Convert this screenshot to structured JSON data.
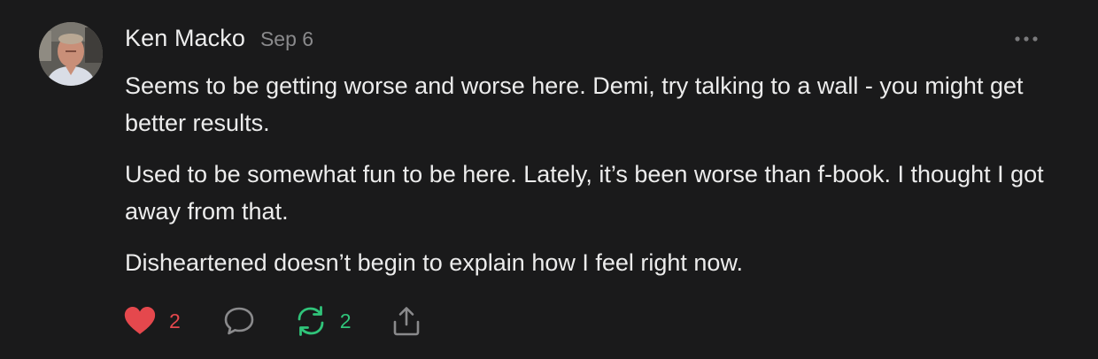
{
  "post": {
    "author": "Ken Macko",
    "date": "Sep 6",
    "paragraphs": [
      "Seems to be getting worse and worse here. Demi, try talking to a wall - you might get better results.",
      "Used to be somewhat fun to be here. Lately, it’s been worse than f-book. I thought I got away from that.",
      "Disheartened doesn’t begin to explain how I feel right now."
    ]
  },
  "actions": {
    "like_count": "2",
    "restack_count": "2"
  },
  "icons": {
    "more": "more-dots-icon",
    "like": "heart-icon",
    "comment": "comment-bubble-icon",
    "restack": "restack-arrows-icon",
    "share": "share-upload-icon"
  },
  "colors": {
    "background": "#1a1a1b",
    "like": "#e5484d",
    "restack": "#30c47a",
    "muted": "#8a8a8c"
  }
}
